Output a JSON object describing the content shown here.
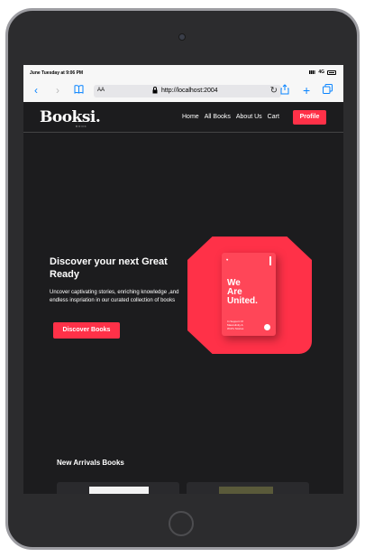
{
  "statusbar": {
    "time": "June Tuesday at 9:06 PM",
    "network": "4G"
  },
  "browser": {
    "text_size": "AA",
    "url": "http://localhost:2004"
  },
  "nav": {
    "logo": "Booksi.",
    "logo_sub": "BOOK",
    "links": [
      "Home",
      "All Books",
      "About Us",
      "Cart"
    ],
    "profile": "Profile"
  },
  "hero": {
    "title": "Discover your next Great Ready",
    "description": "Uncover captivating stories, enriching knowledge ,and endless inspriation in our curated collection of books",
    "cta": "Discover Books",
    "book_title": "We\nAre\nUnited.",
    "book_subtitle": "In Support Of\nMasculinity &\nW.M's Stories"
  },
  "new_arrivals": {
    "title": "New Arrivals Books"
  },
  "colors": {
    "accent": "#ff3148",
    "background": "#1c1c1e"
  },
  "icons": [
    "back-icon",
    "forward-icon",
    "book-icon",
    "lock-icon",
    "reload-icon",
    "share-icon",
    "plus-icon",
    "tabs-icon"
  ]
}
